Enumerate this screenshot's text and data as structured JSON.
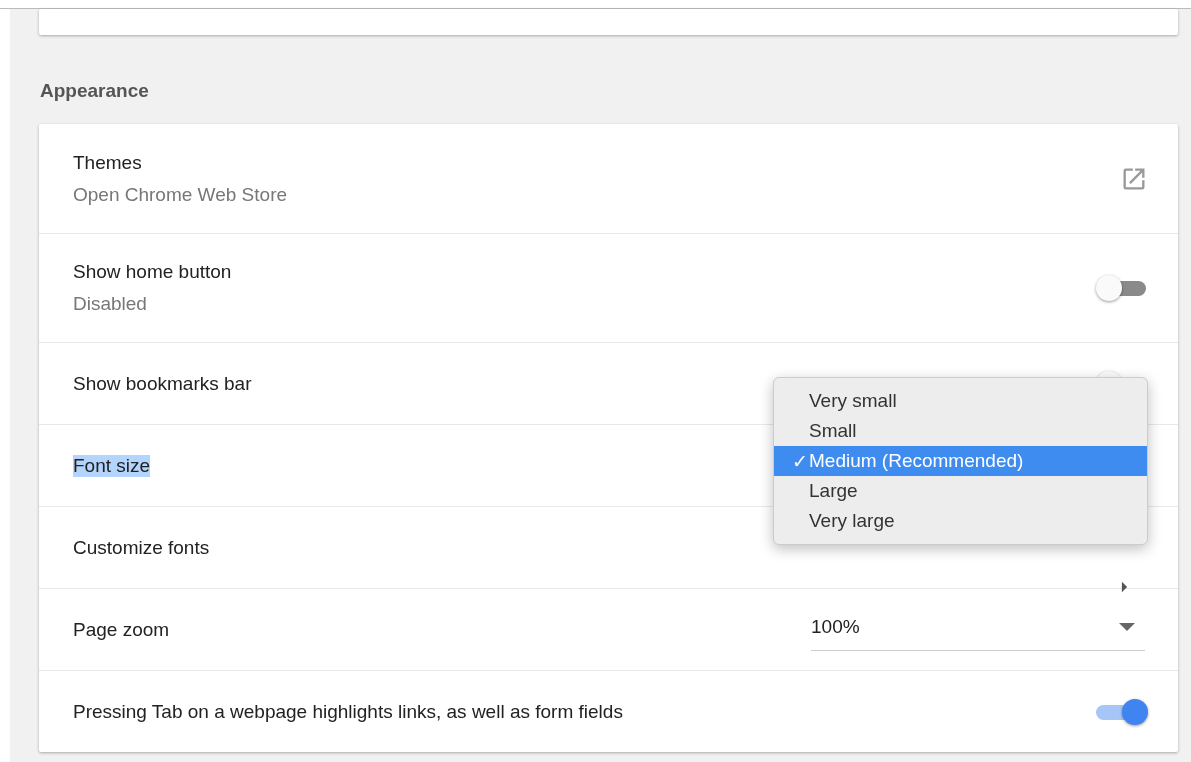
{
  "section_title": "Appearance",
  "rows": [
    {
      "kind": "link",
      "label": "Themes",
      "sublabel": "Open Chrome Web Store"
    },
    {
      "kind": "toggle",
      "label": "Show home button",
      "sublabel": "Disabled",
      "on": false
    },
    {
      "kind": "toggle",
      "label": "Show bookmarks bar",
      "on": false
    },
    {
      "kind": "popup",
      "label": "Font size",
      "highlighted": true
    },
    {
      "kind": "arrow",
      "label": "Customize fonts"
    },
    {
      "kind": "dropdown",
      "label": "Page zoom",
      "value": "100%"
    },
    {
      "kind": "toggle",
      "label": "Pressing Tab on a webpage highlights links, as well as form fields",
      "on": true
    }
  ],
  "popup": {
    "check": "✓",
    "options": [
      {
        "label": "Very small",
        "selected": false
      },
      {
        "label": "Small",
        "selected": false
      },
      {
        "label": "Medium (Recommended)",
        "selected": true
      },
      {
        "label": "Large",
        "selected": false
      },
      {
        "label": "Very large",
        "selected": false
      }
    ]
  }
}
